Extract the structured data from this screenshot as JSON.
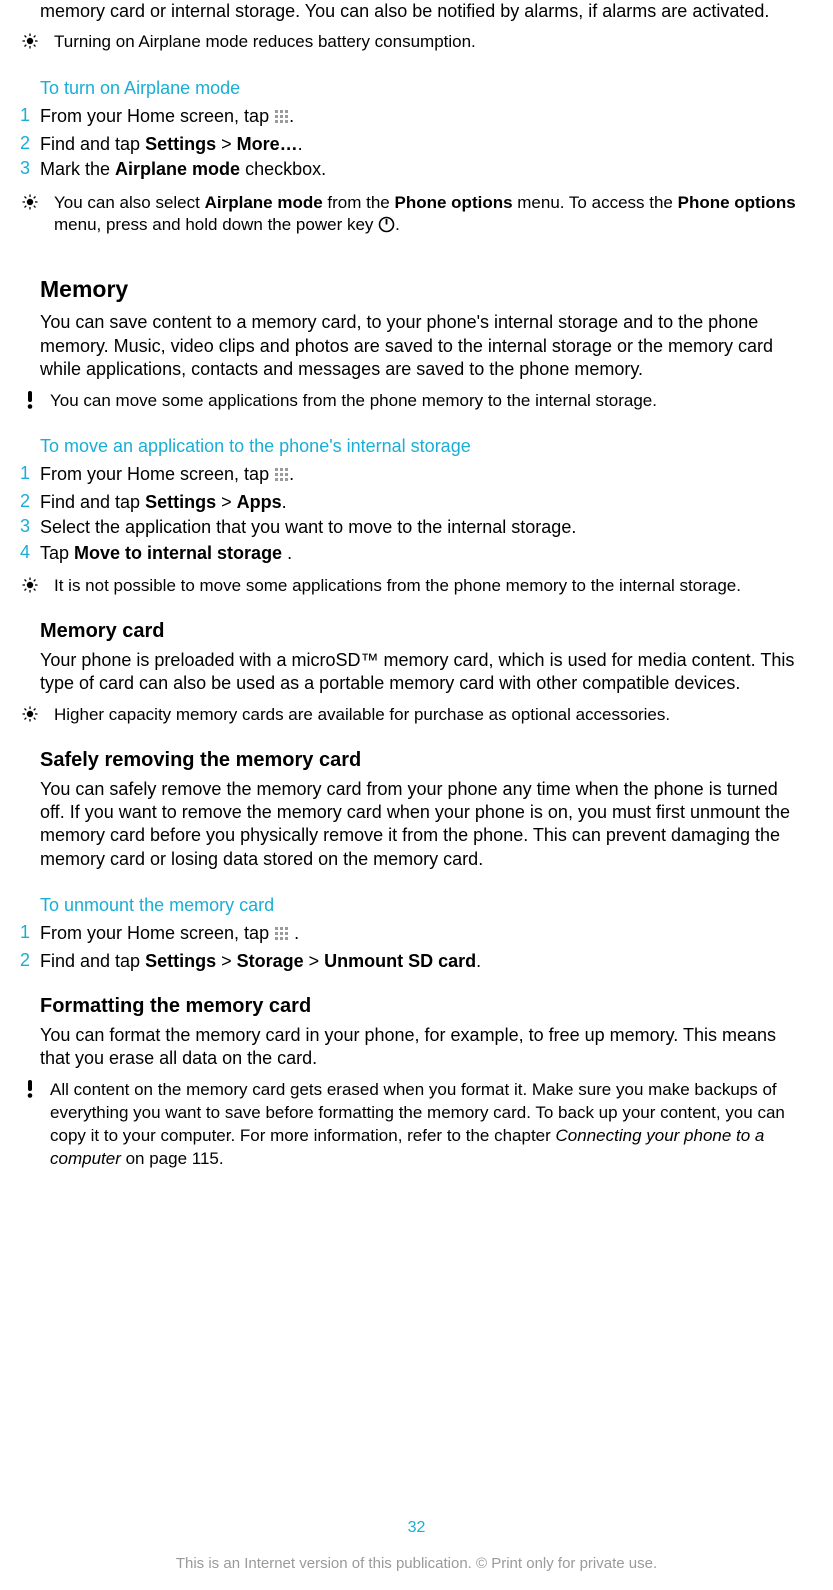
{
  "intro_fragment": "memory card or internal storage. You can also be notified by alarms, if alarms are activated.",
  "tip1": "Turning on Airplane mode reduces battery consumption.",
  "proc1": {
    "title": "To turn on Airplane mode",
    "s1a": "From your Home screen, tap ",
    "s1b": ".",
    "s2a": "Find and tap ",
    "s2b": "Settings",
    "s2c": " > ",
    "s2d": "More…",
    "s2e": ".",
    "s3a": "Mark the ",
    "s3b": "Airplane mode",
    "s3c": " checkbox."
  },
  "tip2a": "You can also select ",
  "tip2b": "Airplane mode",
  "tip2c": " from the ",
  "tip2d": "Phone options",
  "tip2e": " menu. To access the ",
  "tip2f": "Phone options",
  "tip2g": " menu, press and hold down the power key ",
  "tip2h": ".",
  "memory": {
    "heading": "Memory",
    "body": "You can save content to a memory card, to your phone's internal storage and to the phone memory. Music, video clips and photos are saved to the internal storage or the memory card while applications, contacts and messages are saved to the phone memory."
  },
  "note1": "You can move some applications from the phone memory to the internal storage.",
  "proc2": {
    "title": "To move an application to the phone's internal storage",
    "s1a": "From your Home screen, tap ",
    "s1b": ".",
    "s2a": "Find and tap ",
    "s2b": "Settings",
    "s2c": " > ",
    "s2d": "Apps",
    "s2e": ".",
    "s3": "Select the application that you want to move to the internal storage.",
    "s4a": "Tap ",
    "s4b": "Move to internal storage ",
    "s4c": "."
  },
  "tip3": "It is not possible to move some applications from the phone memory to the internal storage.",
  "memcard": {
    "heading": "Memory card",
    "body": "Your phone is preloaded with a microSD™ memory card, which is used for media content. This type of card can also be used as a portable memory card with other compatible devices."
  },
  "tip4": "Higher capacity memory cards are available for purchase as optional accessories.",
  "safely": {
    "heading": "Safely removing the memory card",
    "body": "You can safely remove the memory card from your phone any time when the phone is turned off. If you want to remove the memory card when your phone is on, you must first unmount the memory card before you physically remove it from the phone. This can prevent damaging the memory card or losing data stored on the memory card."
  },
  "proc3": {
    "title": "To unmount the memory card",
    "s1a": "From your Home screen, tap ",
    "s1b": " .",
    "s2a": "Find and tap ",
    "s2b": "Settings",
    "s2c": " > ",
    "s2d": "Storage",
    "s2e": " > ",
    "s2f": "Unmount SD card",
    "s2g": "."
  },
  "format": {
    "heading": "Formatting the memory card",
    "body": "You can format the memory card in your phone, for example, to free up memory. This means that you erase all data on the card."
  },
  "note2a": "All content on the memory card gets erased when you format it. Make sure you make backups of everything you want to save before formatting the memory card. To back up your content, you can copy it to your computer. For more information, refer to the chapter ",
  "note2b": "Connecting your phone to a computer",
  "note2c": " on page 115.",
  "page_number": "32",
  "footer_text": "This is an Internet version of this publication. © Print only for private use.",
  "nums": {
    "n1": "1",
    "n2": "2",
    "n3": "3",
    "n4": "4"
  }
}
